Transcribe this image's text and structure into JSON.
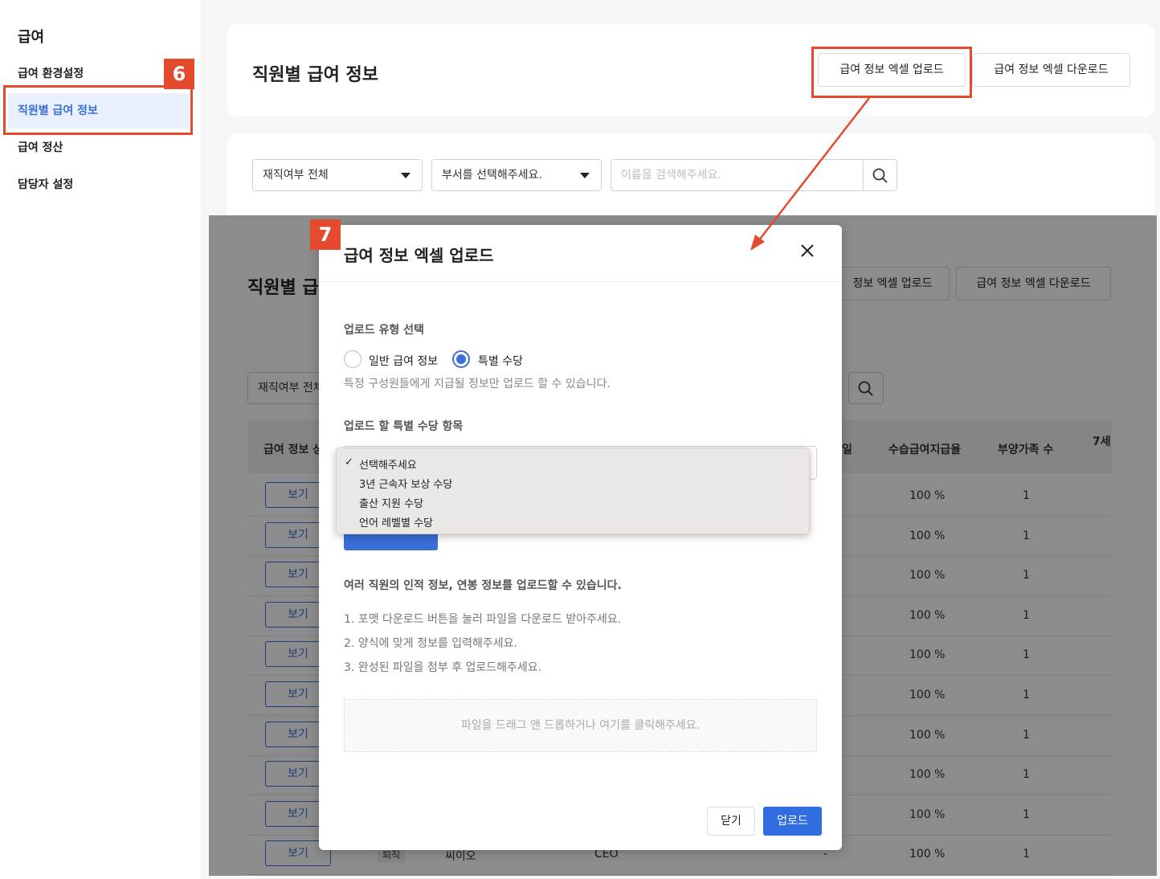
{
  "sidebar": {
    "title": "급여",
    "items": [
      {
        "label": "급여 환경설정"
      },
      {
        "label": "직원별 급여 정보"
      },
      {
        "label": "급여 정산"
      },
      {
        "label": "담당자 설정"
      }
    ]
  },
  "callouts": {
    "step6": "6",
    "step7": "7"
  },
  "header": {
    "title": "직원별 급여 정보",
    "upload_btn": "급여 정보 엑셀 업로드",
    "download_btn": "급여 정보 엑셀 다운로드"
  },
  "filters": {
    "employment": "재직여부 전체",
    "department": "부서를 선택해주세요.",
    "search_placeholder": "이름을 검색해주세요."
  },
  "background_page": {
    "title": "직원별 급",
    "upload_btn": "급여 정보 엑셀 업로드",
    "upload_btn_visible": "정보 엑셀 업로드",
    "download_btn": "급여 정보 엑셀 다운로드",
    "filter": "재직여부 전체",
    "columns": [
      "급여 정보 상",
      "일",
      "수습급여지급율",
      "부양가족 수",
      "7세"
    ],
    "view_label": "보기",
    "rows": [
      {
        "rate": "100 %",
        "dependents": "1"
      },
      {
        "rate": "100 %",
        "dependents": "1"
      },
      {
        "rate": "100 %",
        "dependents": "1"
      },
      {
        "rate": "100 %",
        "dependents": "1"
      },
      {
        "rate": "100 %",
        "dependents": "1"
      },
      {
        "rate": "100 %",
        "dependents": "1"
      },
      {
        "rate": "100 %",
        "dependents": "1"
      },
      {
        "rate": "100 %",
        "dependents": "1"
      },
      {
        "rate": "100 %",
        "dependents": "1"
      },
      {
        "status": "퇴직",
        "name": "씨이오",
        "position": "CEO",
        "date": "-",
        "rate": "100 %",
        "dependents": "1"
      }
    ]
  },
  "modal": {
    "title": "급여 정보 엑셀 업로드",
    "upload_type_label": "업로드 유형 선택",
    "radio_general": "일반 급여 정보",
    "radio_special": "특별 수당",
    "selected_type": "특별 수당",
    "help_text": "특정 구성원들에게 지급될 정보만 업로드 할 수 있습니다.",
    "item_label": "업로드 할 특별 수당 항목",
    "dropdown_options": [
      "선택해주세요",
      "3년 근속자 보상 수당",
      "출산 지원 수당",
      "언어 레벨별 수당"
    ],
    "dropdown_selected": "선택해주세요",
    "info_title": "여러 직원의 인적 정보, 연봉 정보를 업로드할 수 있습니다.",
    "steps": [
      "1. 포맷 다운로드 버튼을 눌러 파일을 다운로드 받아주세요.",
      "2. 양식에 맞게 정보를 입력해주세요.",
      "3. 완성된 파일을 첨부 후 업로드해주세요."
    ],
    "dropzone": "파일을 드래그 앤 드롭하거나 여기를 클릭해주세요.",
    "close_btn": "닫기",
    "upload_btn": "업로드"
  },
  "colors": {
    "accent": "#3b6fd8",
    "callout": "#e34a2e"
  }
}
